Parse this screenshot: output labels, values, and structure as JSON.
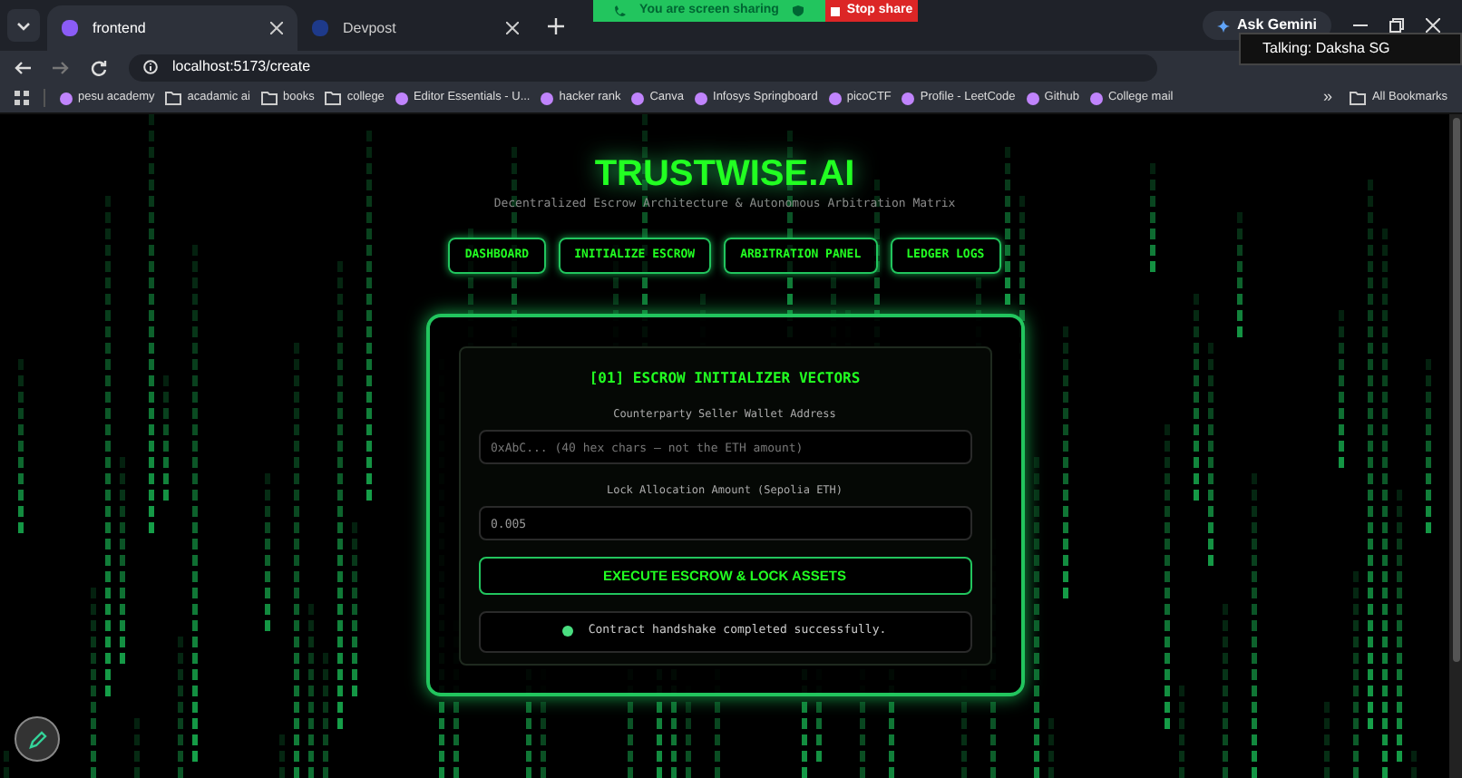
{
  "browser": {
    "tabs": [
      {
        "title": "frontend",
        "selected": true
      },
      {
        "title": "Devpost",
        "selected": false
      }
    ],
    "share_bar": {
      "message": "You are screen sharing",
      "stop_label": "Stop share"
    },
    "gemini_label": "Ask Gemini",
    "tooltip": "Talking: Daksha SG",
    "url": "localhost:5173/create",
    "bookmarks": [
      {
        "label": "pesu academy",
        "kind": "site"
      },
      {
        "label": "acadamic ai",
        "kind": "folder"
      },
      {
        "label": "books",
        "kind": "folder"
      },
      {
        "label": "college",
        "kind": "folder"
      },
      {
        "label": "Editor Essentials - U...",
        "kind": "site"
      },
      {
        "label": "hacker rank",
        "kind": "site"
      },
      {
        "label": "Canva",
        "kind": "site"
      },
      {
        "label": "Infosys Springboard",
        "kind": "site"
      },
      {
        "label": "picoCTF",
        "kind": "site"
      },
      {
        "label": "Profile - LeetCode",
        "kind": "site"
      },
      {
        "label": "Github",
        "kind": "site"
      },
      {
        "label": "College mail",
        "kind": "site"
      }
    ],
    "overflow_label": "»",
    "all_bookmarks": "All Bookmarks"
  },
  "page": {
    "title": "TRUSTWISE.AI",
    "subtitle": "Decentralized Escrow Architecture & Autonomous Arbitration Matrix",
    "nav": [
      {
        "label": "DASHBOARD"
      },
      {
        "label": "INITIALIZE ESCROW"
      },
      {
        "label": "ARBITRATION PANEL"
      },
      {
        "label": "LEDGER LOGS"
      }
    ],
    "form": {
      "heading": "[01] ESCROW INITIALIZER VECTORS",
      "fields": [
        {
          "label": "Counterparty Seller Wallet Address",
          "placeholder": "0xAbC... (40 hex chars — not the ETH amount)"
        },
        {
          "label": "Lock Allocation Amount (Sepolia ETH)",
          "value": "0.005"
        }
      ],
      "submit": "EXECUTE ESCROW & LOCK ASSETS",
      "status": {
        "message": "Contract handshake completed successfully.",
        "color": "#4ade80"
      }
    }
  }
}
